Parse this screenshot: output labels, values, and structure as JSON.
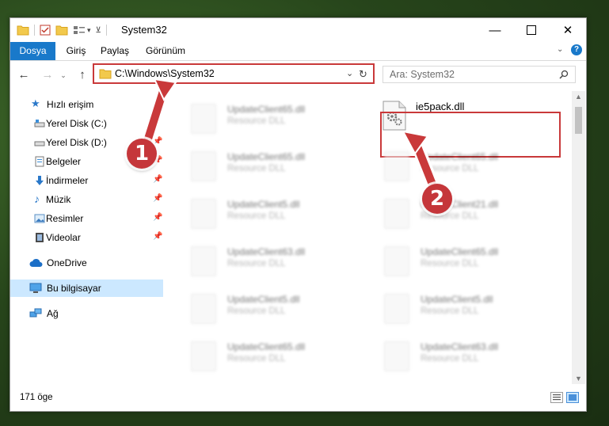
{
  "window": {
    "title": "System32"
  },
  "ribbon": {
    "tabs": [
      "Dosya",
      "Giriş",
      "Paylaş",
      "Görünüm"
    ]
  },
  "address": {
    "path": "C:\\Windows\\System32"
  },
  "search": {
    "placeholder": "Ara: System32"
  },
  "nav": {
    "quick_access": "Hızlı erişim",
    "items": [
      {
        "label": "Yerel Disk (C:)",
        "icon": "drive-icon"
      },
      {
        "label": "Yerel Disk (D:)",
        "icon": "drive-icon"
      },
      {
        "label": "Belgeler",
        "icon": "documents-icon"
      },
      {
        "label": "İndirmeler",
        "icon": "downloads-icon"
      },
      {
        "label": "Müzik",
        "icon": "music-icon"
      },
      {
        "label": "Resimler",
        "icon": "pictures-icon"
      },
      {
        "label": "Videolar",
        "icon": "videos-icon"
      }
    ],
    "onedrive": "OneDrive",
    "this_pc": "Bu bilgisayar",
    "network": "Ağ"
  },
  "files": {
    "highlighted": {
      "name": "ie5pack.dll"
    },
    "left_column": [
      {
        "name": "UpdateClient65.dll",
        "type": "Resource DLL"
      },
      {
        "name": "UpdateClient65.dll",
        "type": "Resource DLL"
      },
      {
        "name": "UpdateClient5.dll",
        "type": "Resource DLL"
      },
      {
        "name": "UpdateClient63.dll",
        "type": "Resource DLL"
      },
      {
        "name": "UpdateClient5.dll",
        "type": "Resource DLL"
      },
      {
        "name": "UpdateClient65.dll",
        "type": "Resource DLL"
      }
    ],
    "right_column": [
      {
        "name": "UpdateClient65.dll",
        "type": "Resource DLL"
      },
      {
        "name": "UpdateClient21.dll",
        "type": "Resource DLL"
      },
      {
        "name": "UpdateClient65.dll",
        "type": "Resource DLL"
      },
      {
        "name": "UpdateClient5.dll",
        "type": "Resource DLL"
      },
      {
        "name": "UpdateClient63.dll",
        "type": "Resource DLL"
      }
    ]
  },
  "status": {
    "count": "171 öge"
  },
  "annotations": {
    "step1": "1",
    "step2": "2",
    "color": "#c9393a"
  }
}
